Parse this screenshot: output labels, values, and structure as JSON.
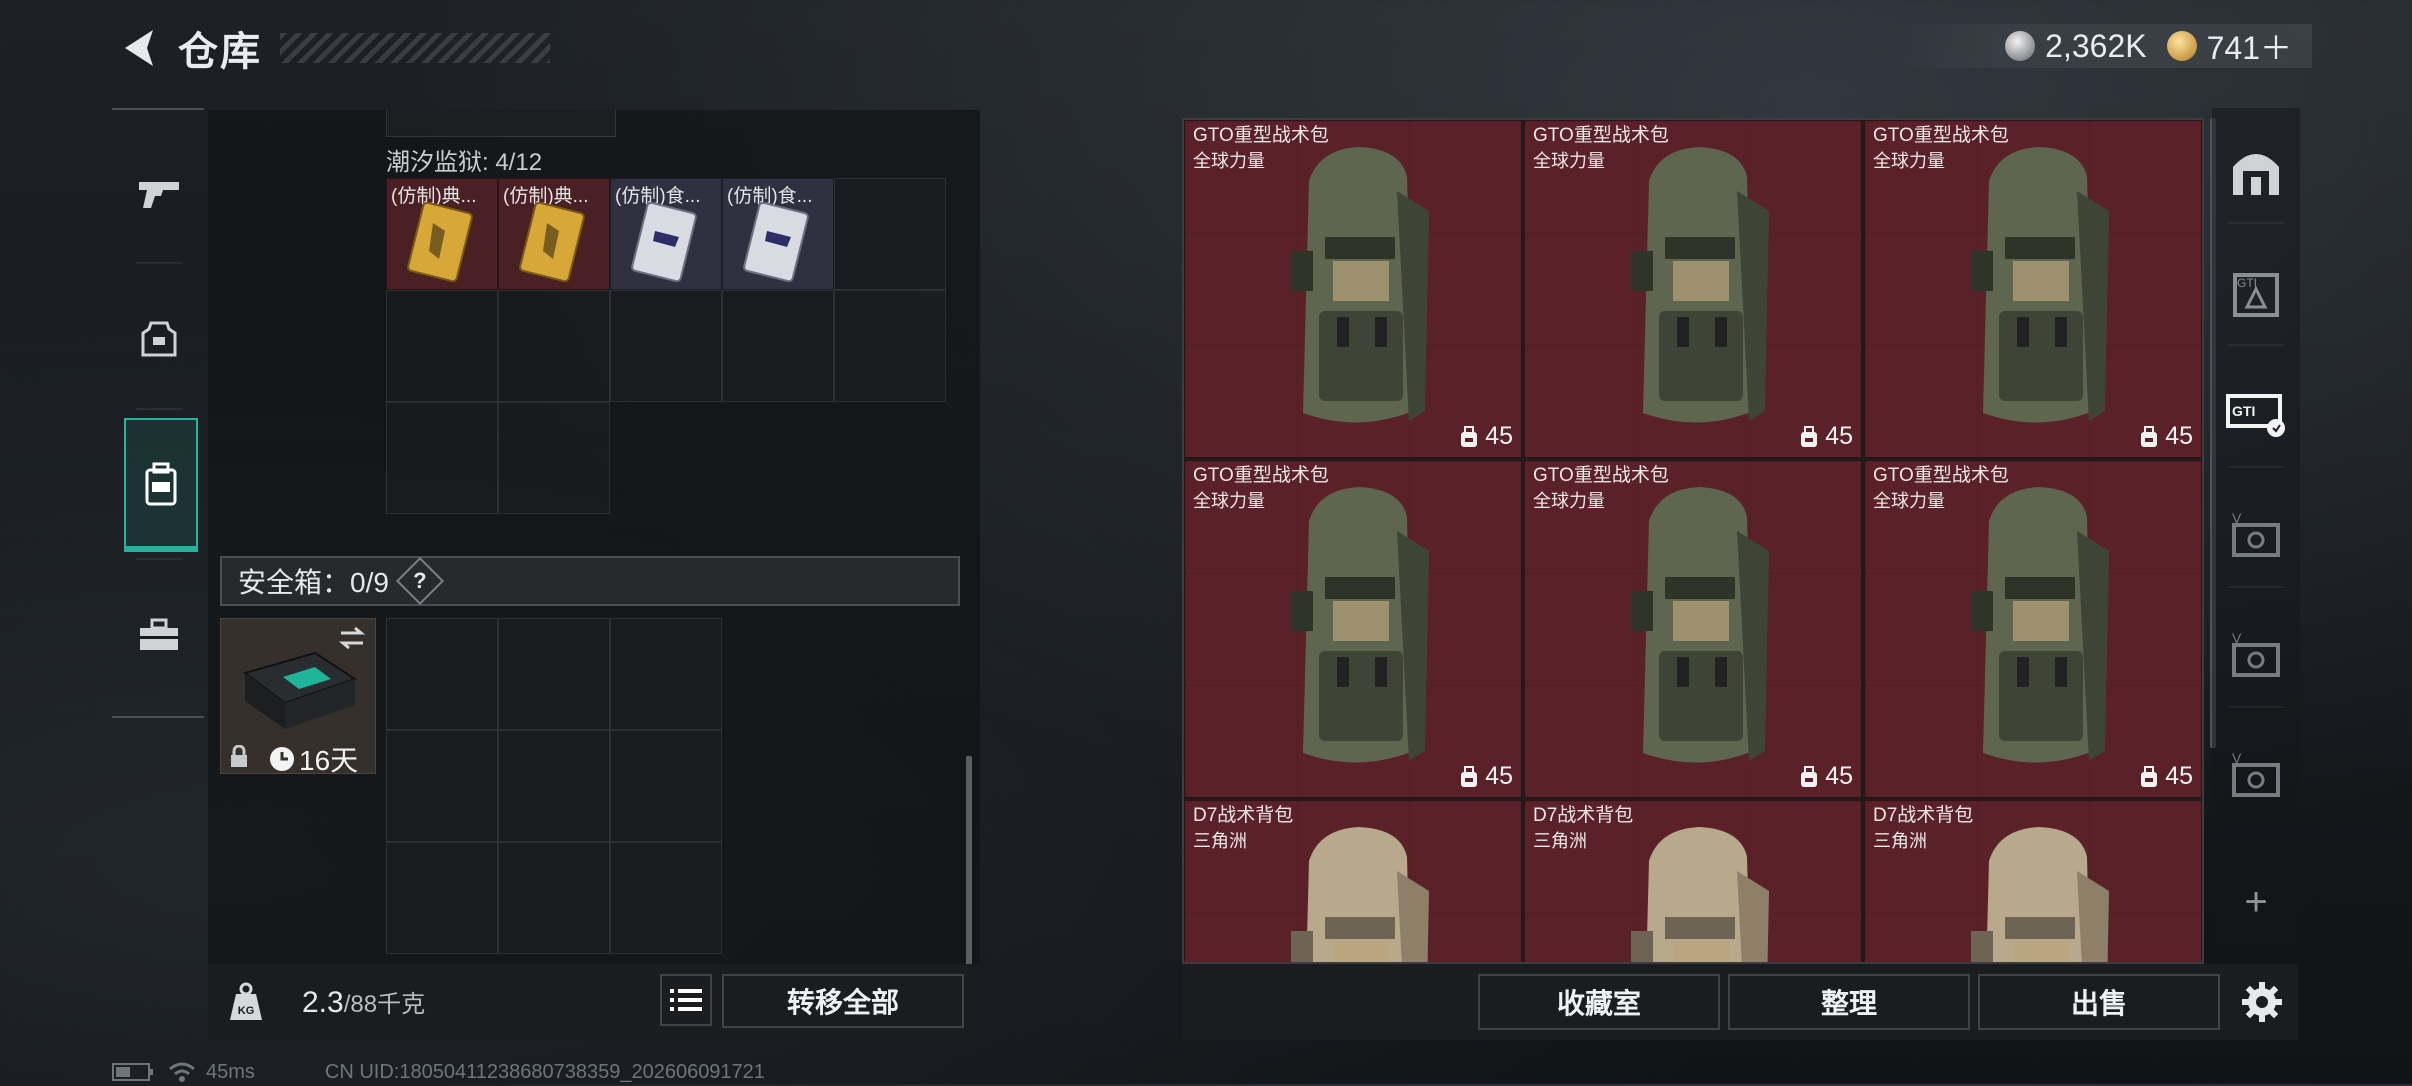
{
  "header": {
    "title": "仓库"
  },
  "currency": {
    "silver": "2,362K",
    "gold": "741＋"
  },
  "sidebar": {
    "items": [
      {
        "icon": "pistol-icon"
      },
      {
        "icon": "armor-icon"
      },
      {
        "icon": "backpack-icon",
        "active": true
      },
      {
        "icon": "toolbox-icon"
      }
    ]
  },
  "container": {
    "section_label": "潮汐监狱: 4/12",
    "items": [
      {
        "label": "(仿制)典...",
        "color": "gold"
      },
      {
        "label": "(仿制)典...",
        "color": "gold"
      },
      {
        "label": "(仿制)食...",
        "color": "silver"
      },
      {
        "label": "(仿制)食...",
        "color": "silver"
      }
    ]
  },
  "safe_box": {
    "label": "安全箱：0/9",
    "help": "?",
    "timer": "16天"
  },
  "footer_left": {
    "weight_current": "2.3",
    "weight_max": "/88千克",
    "transfer_all": "转移全部"
  },
  "stash": {
    "items": [
      {
        "name": "GTO重型战术包",
        "sub": "全球力量",
        "count": "45",
        "color": "#5a2228",
        "bag": "olive"
      },
      {
        "name": "GTO重型战术包",
        "sub": "全球力量",
        "count": "45",
        "color": "#5a2228",
        "bag": "olive"
      },
      {
        "name": "GTO重型战术包",
        "sub": "全球力量",
        "count": "45",
        "color": "#5a2228",
        "bag": "olive"
      },
      {
        "name": "GTO重型战术包",
        "sub": "全球力量",
        "count": "45",
        "color": "#5a2228",
        "bag": "olive"
      },
      {
        "name": "GTO重型战术包",
        "sub": "全球力量",
        "count": "45",
        "color": "#5a2228",
        "bag": "olive"
      },
      {
        "name": "GTO重型战术包",
        "sub": "全球力量",
        "count": "45",
        "color": "#5a2228",
        "bag": "olive"
      },
      {
        "name": "D7战术背包",
        "sub": "三角洲",
        "count": "",
        "color": "#5a2228",
        "bag": "tan"
      },
      {
        "name": "D7战术背包",
        "sub": "三角洲",
        "count": "",
        "color": "#5a2228",
        "bag": "tan"
      },
      {
        "name": "D7战术背包",
        "sub": "三角洲",
        "count": "",
        "color": "#5a2228",
        "bag": "tan"
      }
    ]
  },
  "footer_right": {
    "collection": "收藏室",
    "organize": "整理",
    "sell": "出售"
  },
  "right_sidebar": {
    "icons": [
      "stash-tab-icon",
      "gti-bag-icon",
      "gti-storage-icon",
      "v-box-icon",
      "v-box-icon",
      "v-box-icon"
    ],
    "add": "+"
  },
  "status": {
    "ping": "45ms",
    "uid": "CN UID:18050411238680738359_202606091721"
  }
}
